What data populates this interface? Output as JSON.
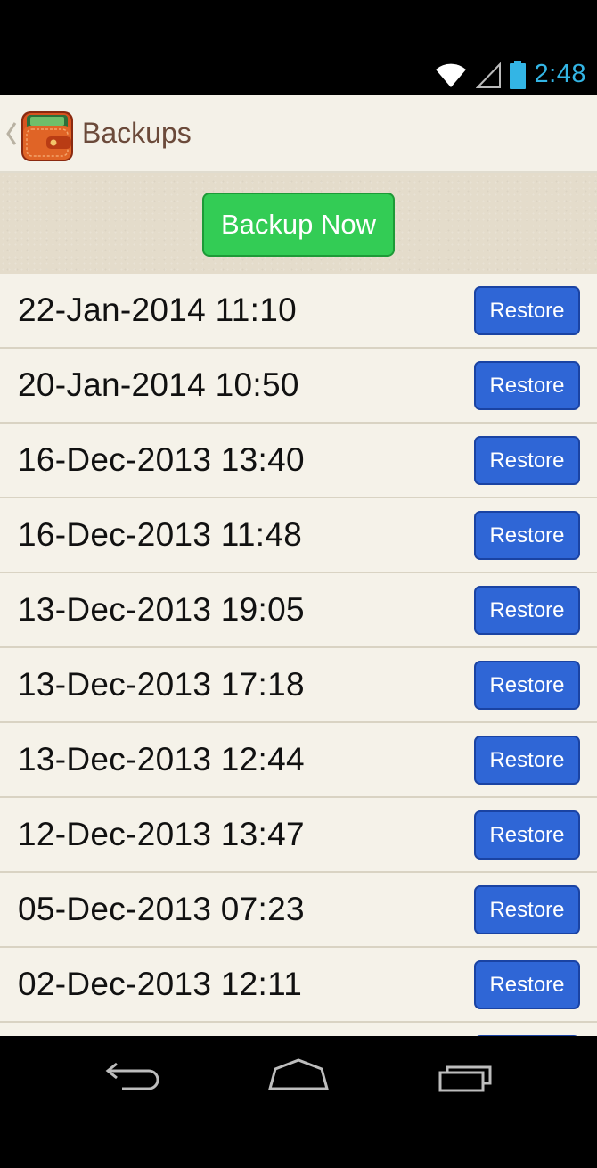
{
  "status_bar": {
    "time": "2:48"
  },
  "action_bar": {
    "title": "Backups"
  },
  "header": {
    "backup_label": "Backup Now"
  },
  "backups": [
    {
      "date": "22-Jan-2014 11:10",
      "action": "Restore"
    },
    {
      "date": "20-Jan-2014 10:50",
      "action": "Restore"
    },
    {
      "date": "16-Dec-2013 13:40",
      "action": "Restore"
    },
    {
      "date": "16-Dec-2013 11:48",
      "action": "Restore"
    },
    {
      "date": "13-Dec-2013 19:05",
      "action": "Restore"
    },
    {
      "date": "13-Dec-2013 17:18",
      "action": "Restore"
    },
    {
      "date": "13-Dec-2013 12:44",
      "action": "Restore"
    },
    {
      "date": "12-Dec-2013 13:47",
      "action": "Restore"
    },
    {
      "date": "05-Dec-2013 07:23",
      "action": "Restore"
    },
    {
      "date": "02-Dec-2013 12:11",
      "action": "Restore"
    }
  ],
  "colors": {
    "accent_status": "#33b5e5",
    "backup_button": "#33cc55",
    "restore_button": "#2f66d6",
    "title_text": "#6b4a3a"
  },
  "icons": {
    "status": [
      "wifi-icon",
      "signal-icon",
      "battery-icon"
    ],
    "nav": [
      "back-icon",
      "home-icon",
      "recents-icon"
    ],
    "app": "wallet-icon"
  }
}
